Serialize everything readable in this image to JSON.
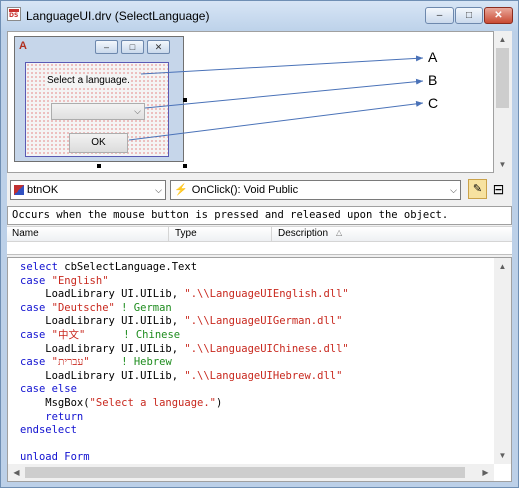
{
  "window": {
    "title": "LanguageUI.drv (SelectLanguage)",
    "buttons": {
      "minimize": "–",
      "maximize": "□",
      "close": "✕"
    }
  },
  "form_preview": {
    "label": "Select a language.",
    "ok_button": "OK",
    "callouts": [
      "A",
      "B",
      "C"
    ]
  },
  "toolbar": {
    "object_combo": "btnOK",
    "event_combo": "OnClick(): Void Public"
  },
  "description": "Occurs when the mouse button is pressed and released upon the object.",
  "columns": {
    "name": "Name",
    "type": "Type",
    "description": "Description"
  },
  "code": {
    "l1a": "select",
    "l1b": " cbSelectLanguage.Text",
    "l2a": "case",
    "l2b": "\"English\"",
    "l3a": "    LoadLibrary UI.UILib, ",
    "l3b": "\".\\\\LanguageUIEnglish.dll\"",
    "l4a": "case",
    "l4b": "\"Deutsche\"",
    "l4c": " ! German",
    "l5a": "    LoadLibrary UI.UILib, ",
    "l5b": "\".\\\\LanguageUIGerman.dll\"",
    "l6a": "case",
    "l6b": "\"中文\"",
    "l6c": "      ! Chinese",
    "l7a": "    LoadLibrary UI.UILib, ",
    "l7b": "\".\\\\LanguageUIChinese.dll\"",
    "l8a": "case",
    "l8b": "\"עברית\"",
    "l8c": "     ! Hebrew",
    "l9a": "    LoadLibrary UI.UILib, ",
    "l9b": "\".\\\\LanguageUIHebrew.dll\"",
    "l10a": "case else",
    "l11a": "    MsgBox(",
    "l11b": "\"Select a language.\"",
    "l11c": ")",
    "l12a": "    return",
    "l13a": "endselect",
    "l15a": "unload Form"
  },
  "colors": {
    "keyword": "#1010d0",
    "string": "#c8281e",
    "comment": "#1e8c1e"
  },
  "icons": [
    "app-icon",
    "object-icon",
    "event-icon",
    "split-icon"
  ]
}
